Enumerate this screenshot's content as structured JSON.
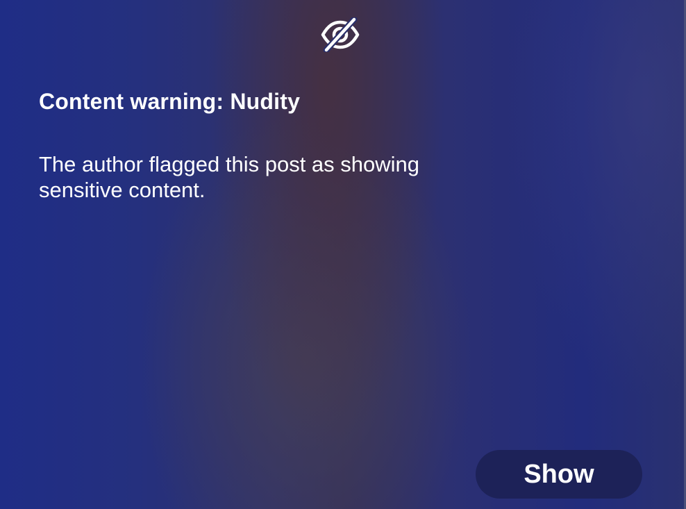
{
  "warning": {
    "icon": "eye-slash-icon",
    "title": "Content warning: Nudity",
    "description": "The author flagged this post as showing sensitive content.",
    "show_label": "Show"
  },
  "colors": {
    "background": "#232c78",
    "button": "#1d2258",
    "text": "#ffffff"
  }
}
